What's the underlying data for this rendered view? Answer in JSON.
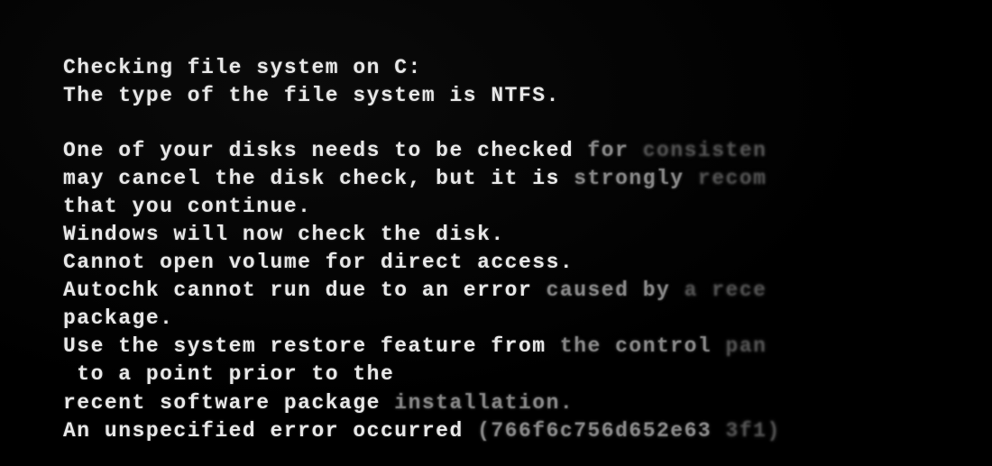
{
  "console": {
    "lines": [
      "Checking file system on C:",
      "The type of the file system is NTFS.",
      "",
      "One of your disks needs to be checked for consisten",
      "may cancel the disk check, but it is strongly recom",
      "that you continue.",
      "Windows will now check the disk.",
      "Cannot open volume for direct access.",
      "Autochk cannot run due to an error caused by a rece",
      "package.",
      "Use the system restore feature from the control pan",
      " to a point prior to the",
      "recent software package installation.",
      "An unspecified error occurred (766f6c756d652e63 3f1)"
    ]
  }
}
